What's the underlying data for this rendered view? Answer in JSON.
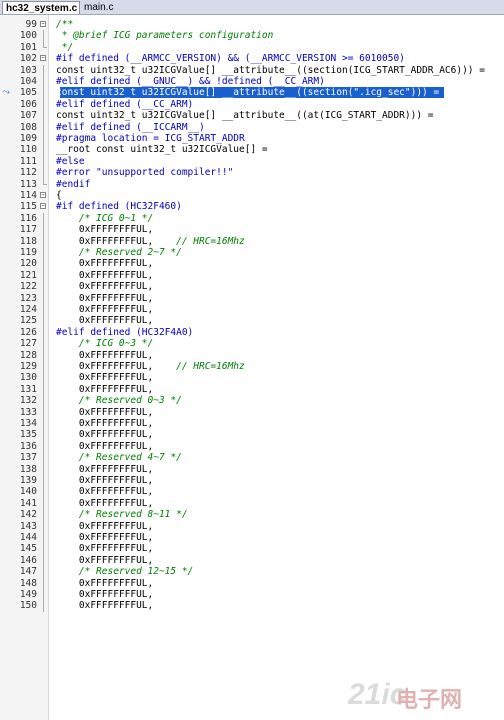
{
  "tabs": [
    {
      "label": "hc32_system.c",
      "active": true
    },
    {
      "label": "main.c",
      "active": false
    }
  ],
  "editor": {
    "highlight_color": "#1a5fd0",
    "comment_color": "#008000",
    "directive_color": "#0000c0",
    "lines": [
      {
        "n": "99",
        "fold": "open",
        "kind": "cmt",
        "text": "/**"
      },
      {
        "n": "100",
        "fold": "line",
        "kind": "cmt",
        "text": " * @brief ICG parameters configuration"
      },
      {
        "n": "101",
        "fold": "end",
        "kind": "cmt",
        "text": " */"
      },
      {
        "n": "102",
        "fold": "open",
        "kind": "dir",
        "text": "#if defined (__ARMCC_VERSION) && (__ARMCC_VERSION >= 6010050)"
      },
      {
        "n": "103",
        "fold": "line",
        "kind": "code",
        "text": "const uint32_t u32ICGValue[] __attribute__((section(ICG_START_ADDR_AC6))) ="
      },
      {
        "n": "104",
        "fold": "line",
        "kind": "dir",
        "text": "#elif defined (__GNUC__) && !defined (__CC_ARM)"
      },
      {
        "n": "105",
        "fold": "line",
        "kind": "hl",
        "text": "const uint32_t u32ICGValue[] __attribute__((section(\".icg_sec\"))) ="
      },
      {
        "n": "106",
        "fold": "line",
        "kind": "dir",
        "text": "#elif defined (__CC_ARM)"
      },
      {
        "n": "107",
        "fold": "line",
        "kind": "code",
        "text": "const uint32_t u32ICGValue[] __attribute__((at(ICG_START_ADDR))) ="
      },
      {
        "n": "108",
        "fold": "line",
        "kind": "dir",
        "text": "#elif defined (__ICCARM__)"
      },
      {
        "n": "109",
        "fold": "line",
        "kind": "dir",
        "text": "#pragma location = ICG_START_ADDR"
      },
      {
        "n": "110",
        "fold": "line",
        "kind": "code",
        "text": "__root const uint32_t u32ICGValue[] ="
      },
      {
        "n": "111",
        "fold": "line",
        "kind": "dir",
        "text": "#else"
      },
      {
        "n": "112",
        "fold": "line",
        "kind": "dir",
        "text": "#error \"unsupported compiler!!\""
      },
      {
        "n": "113",
        "fold": "end",
        "kind": "dir",
        "text": "#endif"
      },
      {
        "n": "114",
        "fold": "open",
        "kind": "code",
        "text": "{"
      },
      {
        "n": "115",
        "fold": "open",
        "kind": "dir",
        "text": "#if defined (HC32F460)"
      },
      {
        "n": "116",
        "fold": "line",
        "kind": "cmt",
        "text": "    /* ICG 0~1 */"
      },
      {
        "n": "117",
        "fold": "line",
        "kind": "code",
        "text": "    0xFFFFFFFFUL,"
      },
      {
        "n": "118",
        "fold": "line",
        "kind": "code",
        "text": "    0xFFFFFFFFUL,",
        "comment": "    // HRC=16Mhz"
      },
      {
        "n": "119",
        "fold": "line",
        "kind": "cmt",
        "text": "    /* Reserved 2~7 */"
      },
      {
        "n": "120",
        "fold": "line",
        "kind": "code",
        "text": "    0xFFFFFFFFUL,"
      },
      {
        "n": "121",
        "fold": "line",
        "kind": "code",
        "text": "    0xFFFFFFFFUL,"
      },
      {
        "n": "122",
        "fold": "line",
        "kind": "code",
        "text": "    0xFFFFFFFFUL,"
      },
      {
        "n": "123",
        "fold": "line",
        "kind": "code",
        "text": "    0xFFFFFFFFUL,"
      },
      {
        "n": "124",
        "fold": "line",
        "kind": "code",
        "text": "    0xFFFFFFFFUL,"
      },
      {
        "n": "125",
        "fold": "line",
        "kind": "code",
        "text": "    0xFFFFFFFFUL,"
      },
      {
        "n": "126",
        "fold": "line",
        "kind": "dir",
        "text": "#elif defined (HC32F4A0)"
      },
      {
        "n": "127",
        "fold": "line",
        "kind": "cmt",
        "text": "    /* ICG 0~3 */"
      },
      {
        "n": "128",
        "fold": "line",
        "kind": "code",
        "text": "    0xFFFFFFFFUL,"
      },
      {
        "n": "129",
        "fold": "line",
        "kind": "code",
        "text": "    0xFFFFFFFFUL,",
        "comment": "    // HRC=16Mhz"
      },
      {
        "n": "130",
        "fold": "line",
        "kind": "code",
        "text": "    0xFFFFFFFFUL,"
      },
      {
        "n": "131",
        "fold": "line",
        "kind": "code",
        "text": "    0xFFFFFFFFUL,"
      },
      {
        "n": "132",
        "fold": "line",
        "kind": "cmt",
        "text": "    /* Reserved 0~3 */"
      },
      {
        "n": "133",
        "fold": "line",
        "kind": "code",
        "text": "    0xFFFFFFFFUL,"
      },
      {
        "n": "134",
        "fold": "line",
        "kind": "code",
        "text": "    0xFFFFFFFFUL,"
      },
      {
        "n": "135",
        "fold": "line",
        "kind": "code",
        "text": "    0xFFFFFFFFUL,"
      },
      {
        "n": "136",
        "fold": "line",
        "kind": "code",
        "text": "    0xFFFFFFFFUL,"
      },
      {
        "n": "137",
        "fold": "line",
        "kind": "cmt",
        "text": "    /* Reserved 4~7 */"
      },
      {
        "n": "138",
        "fold": "line",
        "kind": "code",
        "text": "    0xFFFFFFFFUL,"
      },
      {
        "n": "139",
        "fold": "line",
        "kind": "code",
        "text": "    0xFFFFFFFFUL,"
      },
      {
        "n": "140",
        "fold": "line",
        "kind": "code",
        "text": "    0xFFFFFFFFUL,"
      },
      {
        "n": "141",
        "fold": "line",
        "kind": "code",
        "text": "    0xFFFFFFFFUL,"
      },
      {
        "n": "142",
        "fold": "line",
        "kind": "cmt",
        "text": "    /* Reserved 8~11 */"
      },
      {
        "n": "143",
        "fold": "line",
        "kind": "code",
        "text": "    0xFFFFFFFFUL,"
      },
      {
        "n": "144",
        "fold": "line",
        "kind": "code",
        "text": "    0xFFFFFFFFUL,"
      },
      {
        "n": "145",
        "fold": "line",
        "kind": "code",
        "text": "    0xFFFFFFFFUL,"
      },
      {
        "n": "146",
        "fold": "line",
        "kind": "code",
        "text": "    0xFFFFFFFFUL,"
      },
      {
        "n": "147",
        "fold": "line",
        "kind": "cmt",
        "text": "    /* Reserved 12~15 */"
      },
      {
        "n": "148",
        "fold": "line",
        "kind": "code",
        "text": "    0xFFFFFFFFUL,"
      },
      {
        "n": "149",
        "fold": "line",
        "kind": "code",
        "text": "    0xFFFFFFFFUL,"
      },
      {
        "n": "150",
        "fold": "line",
        "kind": "code",
        "text": "    0xFFFFFFFFUL,"
      }
    ]
  },
  "bookmark_icon": "bookmark-arrow-icon",
  "watermark": {
    "logo": "21ic",
    "text": "电子网"
  }
}
